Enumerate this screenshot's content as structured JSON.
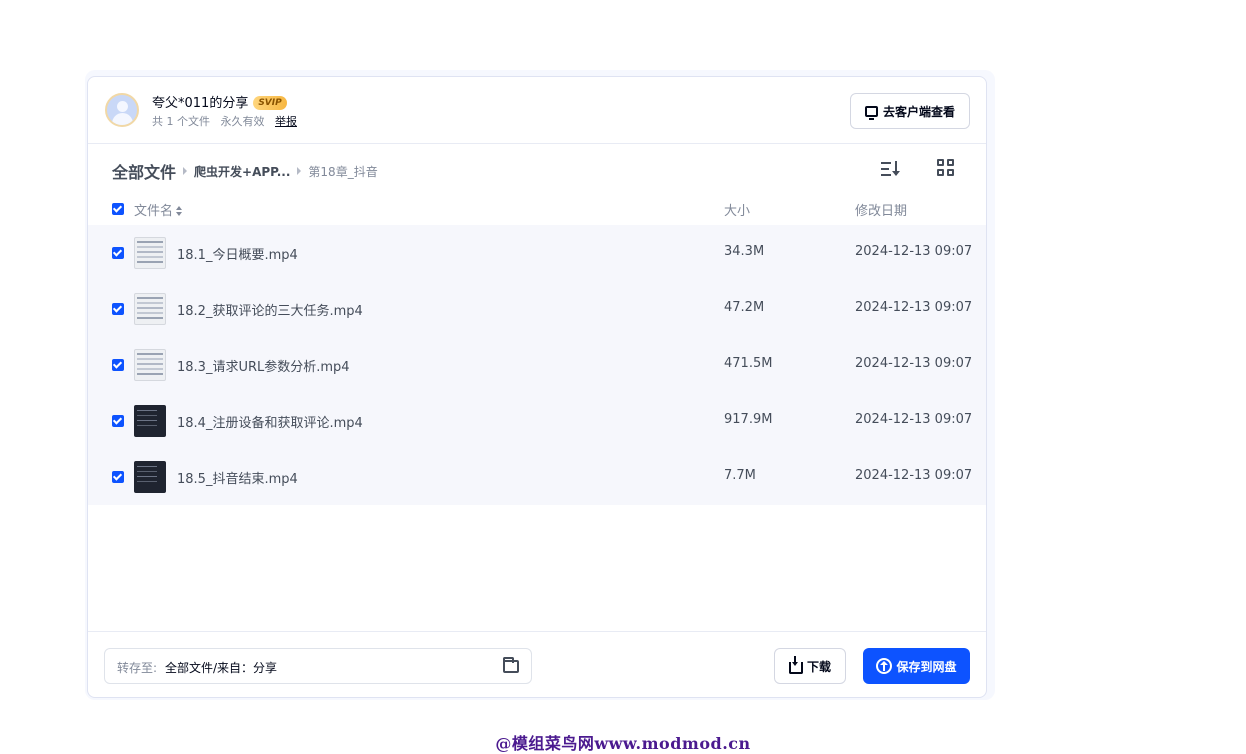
{
  "share": {
    "title": "夸父*011的分享",
    "vip_badge": "SVIP",
    "file_count": "共 1 个文件",
    "validity": "永久有效",
    "report": "举报",
    "client_button": "去客户端查看"
  },
  "breadcrumb": {
    "root": "全部文件",
    "level1": "爬虫开发+APP...",
    "level2": "第18章_抖音"
  },
  "columns": {
    "name": "文件名",
    "size": "大小",
    "date": "修改日期"
  },
  "files": [
    {
      "name": "18.1_今日概要.mp4",
      "size": "34.3M",
      "date": "2024-12-13 09:07",
      "thumb": "light"
    },
    {
      "name": "18.2_获取评论的三大任务.mp4",
      "size": "47.2M",
      "date": "2024-12-13 09:07",
      "thumb": "light"
    },
    {
      "name": "18.3_请求URL参数分析.mp4",
      "size": "471.5M",
      "date": "2024-12-13 09:07",
      "thumb": "light"
    },
    {
      "name": "18.4_注册设备和获取评论.mp4",
      "size": "917.9M",
      "date": "2024-12-13 09:07",
      "thumb": "dark"
    },
    {
      "name": "18.5_抖音结束.mp4",
      "size": "7.7M",
      "date": "2024-12-13 09:07",
      "thumb": "dark"
    }
  ],
  "footer": {
    "dest_label": "转存至:",
    "dest_value": "全部文件/来自：分享",
    "download": "下载",
    "save": "保存到网盘"
  },
  "watermark": "@模组菜鸟网www.modmod.cn",
  "colors": {
    "accent": "#0d53ff",
    "row_bg": "#f6f7fc"
  }
}
